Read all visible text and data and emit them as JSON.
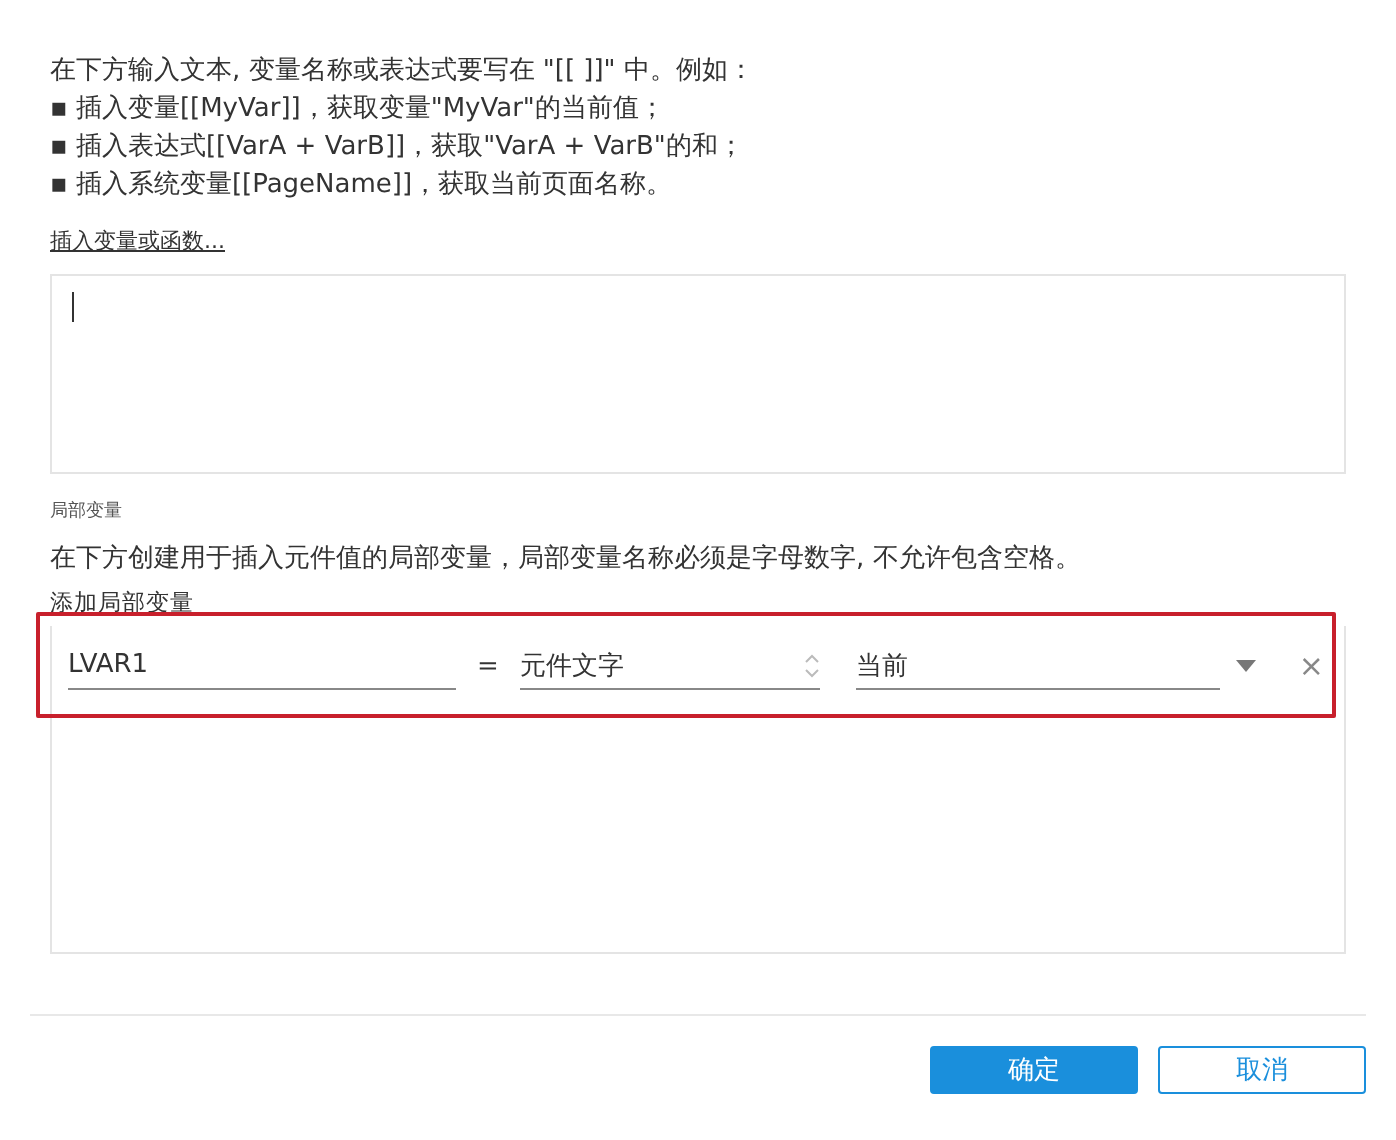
{
  "intro": {
    "lines": [
      "在下方输入文本, 变量名称或表达式要写在 \"[[ ]]\" 中。例如：",
      "▪ 插入变量[[MyVar]]，获取变量\"MyVar\"的当前值；",
      "▪ 插入表达式[[VarA + VarB]]，获取\"VarA + VarB\"的和；",
      "▪ 插入系统变量[[PageName]]，获取当前页面名称。"
    ]
  },
  "insert_link": "插入变量或函数...",
  "text_area": {
    "focused": true
  },
  "local_variables": {
    "section_label": "局部变量",
    "description": "在下方创建用于插入元件值的局部变量，局部变量名称必须是字母数字, 不允许包含空格。",
    "add_link": "添加局部变量",
    "rows": [
      {
        "name": "LVAR1",
        "operator": "=",
        "source": "元件文字",
        "target": "当前",
        "highlighted": true,
        "remove": "×"
      }
    ]
  },
  "buttons": [
    {
      "label": "确定",
      "kind": "primary"
    },
    {
      "label": "取消",
      "kind": "secondary"
    }
  ]
}
